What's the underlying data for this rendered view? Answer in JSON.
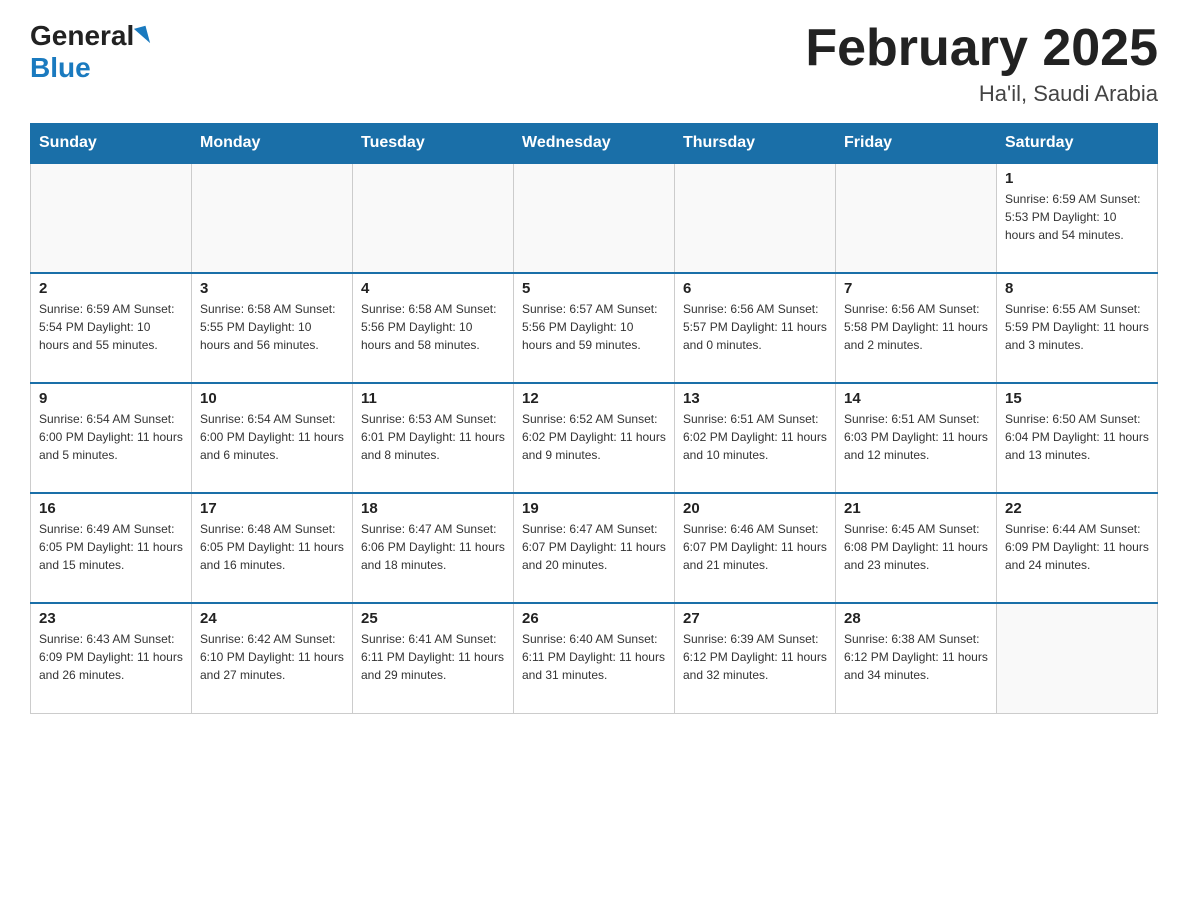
{
  "logo": {
    "general": "General",
    "blue": "Blue"
  },
  "title": "February 2025",
  "subtitle": "Ha'il, Saudi Arabia",
  "weekdays": [
    "Sunday",
    "Monday",
    "Tuesday",
    "Wednesday",
    "Thursday",
    "Friday",
    "Saturday"
  ],
  "weeks": [
    [
      {
        "day": "",
        "info": ""
      },
      {
        "day": "",
        "info": ""
      },
      {
        "day": "",
        "info": ""
      },
      {
        "day": "",
        "info": ""
      },
      {
        "day": "",
        "info": ""
      },
      {
        "day": "",
        "info": ""
      },
      {
        "day": "1",
        "info": "Sunrise: 6:59 AM\nSunset: 5:53 PM\nDaylight: 10 hours\nand 54 minutes."
      }
    ],
    [
      {
        "day": "2",
        "info": "Sunrise: 6:59 AM\nSunset: 5:54 PM\nDaylight: 10 hours\nand 55 minutes."
      },
      {
        "day": "3",
        "info": "Sunrise: 6:58 AM\nSunset: 5:55 PM\nDaylight: 10 hours\nand 56 minutes."
      },
      {
        "day": "4",
        "info": "Sunrise: 6:58 AM\nSunset: 5:56 PM\nDaylight: 10 hours\nand 58 minutes."
      },
      {
        "day": "5",
        "info": "Sunrise: 6:57 AM\nSunset: 5:56 PM\nDaylight: 10 hours\nand 59 minutes."
      },
      {
        "day": "6",
        "info": "Sunrise: 6:56 AM\nSunset: 5:57 PM\nDaylight: 11 hours\nand 0 minutes."
      },
      {
        "day": "7",
        "info": "Sunrise: 6:56 AM\nSunset: 5:58 PM\nDaylight: 11 hours\nand 2 minutes."
      },
      {
        "day": "8",
        "info": "Sunrise: 6:55 AM\nSunset: 5:59 PM\nDaylight: 11 hours\nand 3 minutes."
      }
    ],
    [
      {
        "day": "9",
        "info": "Sunrise: 6:54 AM\nSunset: 6:00 PM\nDaylight: 11 hours\nand 5 minutes."
      },
      {
        "day": "10",
        "info": "Sunrise: 6:54 AM\nSunset: 6:00 PM\nDaylight: 11 hours\nand 6 minutes."
      },
      {
        "day": "11",
        "info": "Sunrise: 6:53 AM\nSunset: 6:01 PM\nDaylight: 11 hours\nand 8 minutes."
      },
      {
        "day": "12",
        "info": "Sunrise: 6:52 AM\nSunset: 6:02 PM\nDaylight: 11 hours\nand 9 minutes."
      },
      {
        "day": "13",
        "info": "Sunrise: 6:51 AM\nSunset: 6:02 PM\nDaylight: 11 hours\nand 10 minutes."
      },
      {
        "day": "14",
        "info": "Sunrise: 6:51 AM\nSunset: 6:03 PM\nDaylight: 11 hours\nand 12 minutes."
      },
      {
        "day": "15",
        "info": "Sunrise: 6:50 AM\nSunset: 6:04 PM\nDaylight: 11 hours\nand 13 minutes."
      }
    ],
    [
      {
        "day": "16",
        "info": "Sunrise: 6:49 AM\nSunset: 6:05 PM\nDaylight: 11 hours\nand 15 minutes."
      },
      {
        "day": "17",
        "info": "Sunrise: 6:48 AM\nSunset: 6:05 PM\nDaylight: 11 hours\nand 16 minutes."
      },
      {
        "day": "18",
        "info": "Sunrise: 6:47 AM\nSunset: 6:06 PM\nDaylight: 11 hours\nand 18 minutes."
      },
      {
        "day": "19",
        "info": "Sunrise: 6:47 AM\nSunset: 6:07 PM\nDaylight: 11 hours\nand 20 minutes."
      },
      {
        "day": "20",
        "info": "Sunrise: 6:46 AM\nSunset: 6:07 PM\nDaylight: 11 hours\nand 21 minutes."
      },
      {
        "day": "21",
        "info": "Sunrise: 6:45 AM\nSunset: 6:08 PM\nDaylight: 11 hours\nand 23 minutes."
      },
      {
        "day": "22",
        "info": "Sunrise: 6:44 AM\nSunset: 6:09 PM\nDaylight: 11 hours\nand 24 minutes."
      }
    ],
    [
      {
        "day": "23",
        "info": "Sunrise: 6:43 AM\nSunset: 6:09 PM\nDaylight: 11 hours\nand 26 minutes."
      },
      {
        "day": "24",
        "info": "Sunrise: 6:42 AM\nSunset: 6:10 PM\nDaylight: 11 hours\nand 27 minutes."
      },
      {
        "day": "25",
        "info": "Sunrise: 6:41 AM\nSunset: 6:11 PM\nDaylight: 11 hours\nand 29 minutes."
      },
      {
        "day": "26",
        "info": "Sunrise: 6:40 AM\nSunset: 6:11 PM\nDaylight: 11 hours\nand 31 minutes."
      },
      {
        "day": "27",
        "info": "Sunrise: 6:39 AM\nSunset: 6:12 PM\nDaylight: 11 hours\nand 32 minutes."
      },
      {
        "day": "28",
        "info": "Sunrise: 6:38 AM\nSunset: 6:12 PM\nDaylight: 11 hours\nand 34 minutes."
      },
      {
        "day": "",
        "info": ""
      }
    ]
  ]
}
